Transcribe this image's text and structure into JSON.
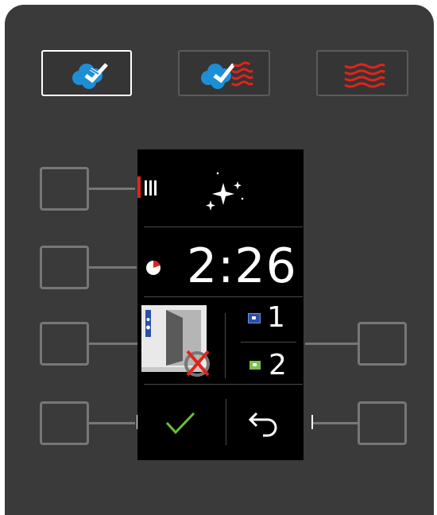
{
  "mode_buttons": [
    {
      "icon": "steam-icon",
      "state": "selected"
    },
    {
      "icon": "combi-steam-heat-icon",
      "state": "normal"
    },
    {
      "icon": "hot-air-icon",
      "state": "normal"
    }
  ],
  "display": {
    "level_icon": "intensity-level-icon",
    "status_icon": "sparkle-clean-icon",
    "timer_icon": "timer-icon",
    "time": "2:26",
    "unit_icon": "oven-rack-blocked-icon",
    "racks": [
      {
        "label": "1",
        "color": "#2a4fa8"
      },
      {
        "label": "2",
        "color": "#7cc04a"
      }
    ],
    "confirm_icon": "check-icon",
    "back_icon": "back-arrow-icon"
  },
  "colors": {
    "accent_red": "#e2231a",
    "steam_blue": "#1e8fd6",
    "confirm_green": "#6abf3a"
  }
}
